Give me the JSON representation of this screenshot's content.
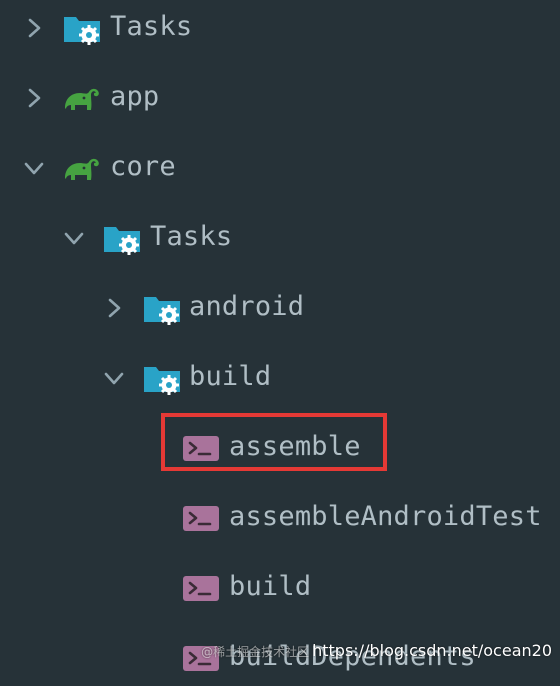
{
  "colors": {
    "background": "#263238",
    "text": "#b0bec5",
    "chevron": "#90a4ae",
    "folder": "#29a3c7",
    "gear": "#ffffff",
    "gradle": "#46a341",
    "task_icon": "#a9739b",
    "highlight": "#e53935"
  },
  "tree": [
    {
      "label": "Tasks",
      "expanded": false,
      "icon": "folder-gear-icon"
    },
    {
      "label": "app",
      "expanded": false,
      "icon": "gradle-elephant-icon"
    },
    {
      "label": "core",
      "expanded": true,
      "icon": "gradle-elephant-icon"
    },
    {
      "label": "Tasks",
      "expanded": true,
      "icon": "folder-gear-icon"
    },
    {
      "label": "android",
      "expanded": false,
      "icon": "folder-gear-icon"
    },
    {
      "label": "build",
      "expanded": true,
      "icon": "folder-gear-icon"
    },
    {
      "label": "assemble",
      "icon": "terminal-task-icon",
      "highlighted": true
    },
    {
      "label": "assembleAndroidTest",
      "icon": "terminal-task-icon"
    },
    {
      "label": "build",
      "icon": "terminal-task-icon"
    },
    {
      "label": "buildDependents",
      "icon": "terminal-task-icon"
    }
  ],
  "watermark": {
    "cjk": "@稀土掘金技术社区",
    "url": "https://blog.csdn.net/ocean20"
  }
}
